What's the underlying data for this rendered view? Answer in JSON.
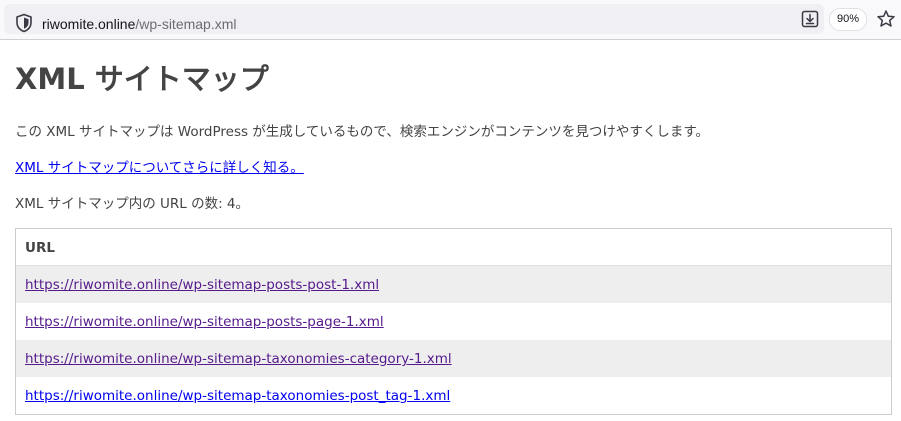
{
  "browser": {
    "url_domain": "riwomite.online",
    "url_path": "/wp-sitemap.xml",
    "zoom": "90%",
    "icons": [
      "shield-icon",
      "download-icon",
      "star-icon"
    ]
  },
  "page": {
    "title": "XML サイトマップ",
    "description": "この XML サイトマップは WordPress が生成しているもので、検索エンジンがコンテンツを見つけやすくします。",
    "learn_more": "XML サイトマップについてさらに詳しく知る。",
    "count": "XML サイトマップ内の URL の数: 4。"
  },
  "table": {
    "header": "URL",
    "rows": [
      {
        "url": "https://riwomite.online/wp-sitemap-posts-post-1.xml",
        "visited": true
      },
      {
        "url": "https://riwomite.online/wp-sitemap-posts-page-1.xml",
        "visited": true
      },
      {
        "url": "https://riwomite.online/wp-sitemap-taxonomies-category-1.xml",
        "visited": true
      },
      {
        "url": "https://riwomite.online/wp-sitemap-taxonomies-post_tag-1.xml",
        "visited": false
      }
    ]
  },
  "colors": {
    "link": "#0000ee",
    "visited": "#551a8b",
    "text": "#444444",
    "row_alt": "#eeeeee"
  }
}
